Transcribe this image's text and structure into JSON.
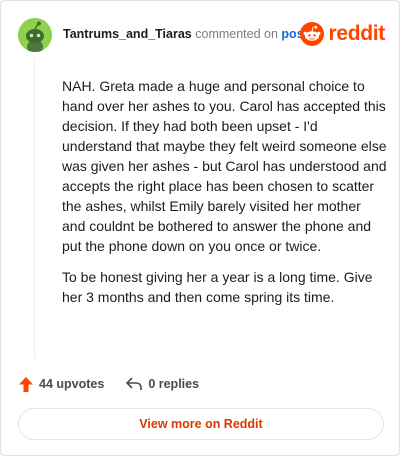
{
  "comment": {
    "username": "Tantrums_and_Tiaras",
    "action_text": "commented on",
    "post_link": "post",
    "paragraphs": [
      "NAH. Greta made a huge and personal choice to hand over her ashes to you. Carol has accepted this decision. If they had both been upset - I'd understand that maybe they felt weird someone else was given her ashes - but Carol has understood and accepts the right place has been chosen to scatter the ashes, whilst Emily barely visited her mother and couldnt be bothered to answer the phone and put the phone down on you once or twice.",
      "To be honest giving her a year is a long time. Give her 3 months and then come spring its time."
    ],
    "upvotes": "44 upvotes",
    "replies": "0 replies"
  },
  "brand": {
    "name": "reddit",
    "icon": "reddit-snoo-icon",
    "color": "#ff4500"
  },
  "footer": {
    "view_button": "View more on Reddit"
  },
  "colors": {
    "upvote": "#ff4500",
    "link": "#1a6bd3",
    "button_text": "#d93a00",
    "avatar_bg": "#8fd14f"
  }
}
